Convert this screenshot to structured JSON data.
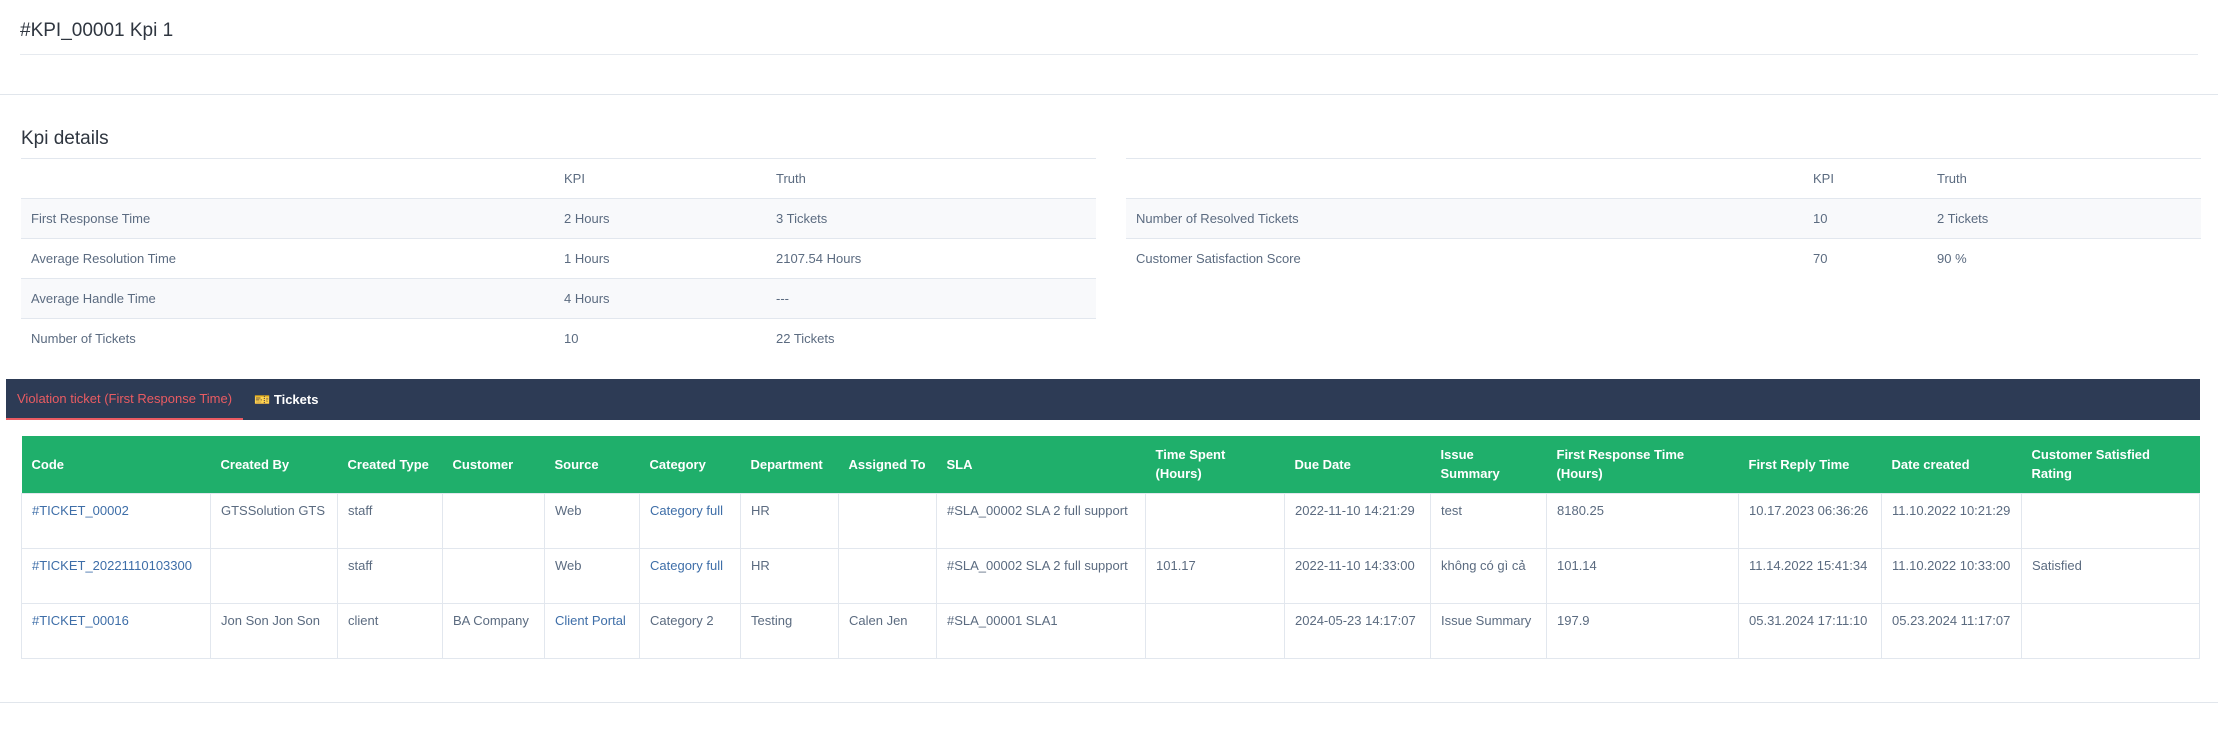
{
  "title": "#KPI_00001 Kpi 1",
  "section_title": "Kpi details",
  "left_table": {
    "headers": [
      "",
      "KPI",
      "Truth"
    ],
    "rows": [
      [
        "First Response Time",
        "2 Hours",
        "3 Tickets"
      ],
      [
        "Average Resolution Time",
        "1 Hours",
        "2107.54 Hours"
      ],
      [
        "Average Handle Time",
        "4 Hours",
        "---"
      ],
      [
        "Number of Tickets",
        "10",
        "22 Tickets"
      ]
    ]
  },
  "right_table": {
    "headers": [
      "",
      "KPI",
      "Truth"
    ],
    "rows": [
      [
        "Number of Resolved Tickets",
        "10",
        "2 Tickets"
      ],
      [
        "Customer Satisfaction Score",
        "70",
        "90 %"
      ]
    ]
  },
  "tabs": [
    {
      "label": "Violation ticket (First Response Time)",
      "active": true
    },
    {
      "label": "Tickets",
      "icon": "ticket-icon"
    }
  ],
  "tickets": {
    "headers": [
      "Code",
      "Created By",
      "Created Type",
      "Customer",
      "Source",
      "Category",
      "Department",
      "Assigned To",
      "SLA",
      "Time Spent (Hours)",
      "Due Date",
      "Issue Summary",
      "First Response Time (Hours)",
      "First Reply Time",
      "Date created",
      "Customer Satisfied Rating"
    ],
    "rows": [
      [
        "#TICKET_00002",
        "GTSSolution GTS",
        "staff",
        "",
        "Web",
        "Category full",
        "HR",
        "",
        "#SLA_00002 SLA 2 full support",
        "",
        "2022-11-10 14:21:29",
        "test",
        "8180.25",
        "10.17.2023 06:36:26",
        "11.10.2022 10:21:29",
        ""
      ],
      [
        "#TICKET_20221110103300",
        "",
        "staff",
        "",
        "Web",
        "Category full",
        "HR",
        "",
        "#SLA_00002 SLA 2 full support",
        "101.17",
        "2022-11-10 14:33:00",
        "không có gì cả",
        "101.14",
        "11.14.2022 15:41:34",
        "11.10.2022 10:33:00",
        "Satisfied"
      ],
      [
        "#TICKET_00016",
        "Jon Son Jon Son",
        "client",
        "BA Company",
        "Client Portal",
        "Category 2",
        "Testing",
        "Calen Jen",
        "#SLA_00001 SLA1",
        "",
        "2024-05-23 14:17:07",
        "Issue Summary",
        "197.9",
        "05.31.2024 17:11:10",
        "05.23.2024 11:17:07",
        ""
      ]
    ]
  },
  "colors": {
    "header_green": "#1faf6b",
    "tabbar": "#2d3b55",
    "active_tab": "#ea5b62",
    "link": "#3e6ea8"
  }
}
